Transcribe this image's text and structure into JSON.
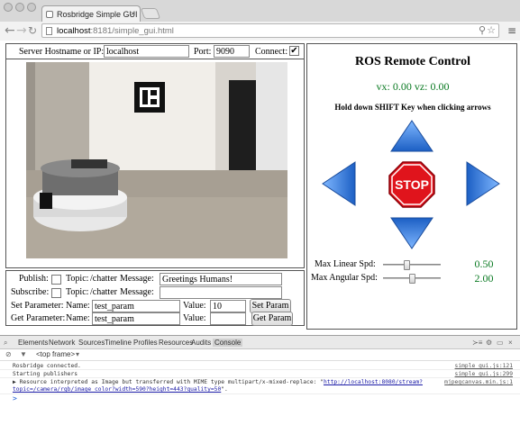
{
  "browser": {
    "tab_title": "Rosbridge Simple GUI",
    "url_host": "localhost",
    "url_rest": ":8181/simple_gui.html"
  },
  "connection": {
    "hostname_label": "Server Hostname or IP:",
    "hostname_value": "localhost",
    "port_label": "Port:",
    "port_value": "9090",
    "connect_label": "Connect:",
    "connect_checked": "✔"
  },
  "camera": {
    "marker_icon": "ar-marker"
  },
  "topics": {
    "publish_label": "Publish:",
    "subscribe_label": "Subscribe:",
    "topic_label": "Topic:",
    "publish_topic": "/chatter",
    "subscribe_topic": "/chatter",
    "message_label": "Message:",
    "publish_message": "Greetings Humans!",
    "subscribe_message": ""
  },
  "params": {
    "set_label": "Set Parameter:",
    "get_label": "Get Parameter:",
    "name_label": "Name:",
    "value_label": "Value:",
    "set_name": "test_param",
    "get_name": "test_param",
    "set_value": "10",
    "get_value": "",
    "set_button": "Set Param",
    "get_button": "Get Param"
  },
  "control": {
    "title": "ROS Remote Control",
    "velocity": "vx: 0.00 vz: 0.00",
    "hint": "Hold down SHIFT Key when clicking arrows",
    "stop_label": "STOP",
    "max_linear_label": "Max Linear Spd:",
    "max_angular_label": "Max Angular Spd:",
    "max_linear_value": "0.50",
    "max_angular_value": "2.00",
    "max_linear_fraction": 0.4,
    "max_angular_fraction": 0.5,
    "arrow_color": "#2a78d8",
    "stop_color": "#e0141c",
    "value_color": "#0a7a22"
  },
  "devtools": {
    "tabs": [
      "Elements",
      "Network",
      "Sources",
      "Timeline",
      "Profiles",
      "Resources",
      "Audits",
      "Console"
    ],
    "frame": "<top frame>",
    "logs": [
      {
        "text": "Rosbridge connected.",
        "source": "simple_gui.js:121"
      },
      {
        "text": "Starting publishers",
        "source": "simple_gui.js:299"
      },
      {
        "text": "▶ Resource interpreted as Image but transferred with MIME type multipart/x-mixed-replace: \"",
        "link": "http://localhost:8080/stream?topic=/camera/rgb/image_color?width=590?height=443?quality=50",
        "tail": "\".",
        "source": "mjpegcanvas.min.js:1"
      }
    ],
    "prompt": ">"
  }
}
